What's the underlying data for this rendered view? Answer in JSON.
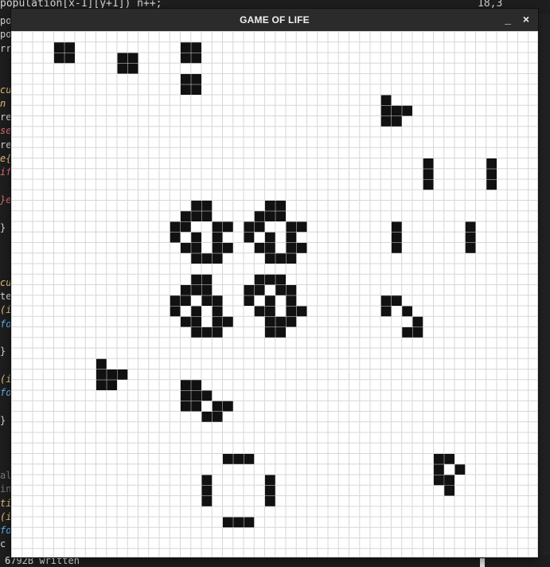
{
  "editor": {
    "top_line": "population[x-1][y+1]) n++;",
    "cursor_position": "18,3",
    "bottom_status": "6792B written",
    "left_fragments": [
      {
        "text": "po",
        "cls": "c-default"
      },
      {
        "text": "po",
        "cls": "c-default"
      },
      {
        "text": "rr",
        "cls": "c-default"
      },
      {
        "text": "",
        "cls": "c-default"
      },
      {
        "text": "",
        "cls": "c-default"
      },
      {
        "text": "cu",
        "cls": "c-yellow"
      },
      {
        "text": "n",
        "cls": "c-yellow"
      },
      {
        "text": "re",
        "cls": "c-default"
      },
      {
        "text": "se",
        "cls": "c-red"
      },
      {
        "text": "re",
        "cls": "c-default"
      },
      {
        "text": "e{",
        "cls": "c-yellow"
      },
      {
        "text": "if",
        "cls": "c-red"
      },
      {
        "text": "",
        "cls": "c-default"
      },
      {
        "text": "}e",
        "cls": "c-red"
      },
      {
        "text": "",
        "cls": "c-default"
      },
      {
        "text": "}",
        "cls": "c-default"
      },
      {
        "text": "",
        "cls": "c-default"
      },
      {
        "text": "",
        "cls": "c-default"
      },
      {
        "text": "",
        "cls": "c-default"
      },
      {
        "text": "cu",
        "cls": "c-yellow"
      },
      {
        "text": "te",
        "cls": "c-default"
      },
      {
        "text": "(i",
        "cls": "c-yellow"
      },
      {
        "text": "fo",
        "cls": "c-blue"
      },
      {
        "text": "",
        "cls": "c-default"
      },
      {
        "text": "}",
        "cls": "c-default"
      },
      {
        "text": "",
        "cls": "c-default"
      },
      {
        "text": "(i",
        "cls": "c-yellow"
      },
      {
        "text": "fo",
        "cls": "c-blue"
      },
      {
        "text": "",
        "cls": "c-default"
      },
      {
        "text": "}",
        "cls": "c-default"
      },
      {
        "text": "",
        "cls": "c-default"
      },
      {
        "text": "",
        "cls": "c-default"
      },
      {
        "text": "",
        "cls": "c-default"
      },
      {
        "text": "al",
        "cls": "c-dim"
      },
      {
        "text": "in",
        "cls": "c-dim"
      },
      {
        "text": "ti",
        "cls": "c-yellow"
      },
      {
        "text": "(i",
        "cls": "c-yellow"
      },
      {
        "text": "fo",
        "cls": "c-blue"
      },
      {
        "text": "c",
        "cls": "c-default"
      }
    ]
  },
  "window": {
    "title": "GAME OF LIFE",
    "minimize_label": "_",
    "close_label": "×"
  },
  "grid": {
    "columns": 50,
    "rows": 50,
    "cell_color": "#111111",
    "grid_line_color": "#d7d7d7",
    "background_color": "#ffffff",
    "cells": [
      [
        4,
        1
      ],
      [
        5,
        1
      ],
      [
        4,
        2
      ],
      [
        5,
        2
      ],
      [
        10,
        2
      ],
      [
        11,
        2
      ],
      [
        10,
        3
      ],
      [
        11,
        3
      ],
      [
        16,
        1
      ],
      [
        17,
        1
      ],
      [
        16,
        2
      ],
      [
        17,
        2
      ],
      [
        16,
        4
      ],
      [
        17,
        4
      ],
      [
        16,
        5
      ],
      [
        17,
        5
      ],
      [
        35,
        6
      ],
      [
        35,
        7
      ],
      [
        36,
        7
      ],
      [
        37,
        7
      ],
      [
        35,
        8
      ],
      [
        36,
        8
      ],
      [
        39,
        12
      ],
      [
        39,
        13
      ],
      [
        39,
        14
      ],
      [
        45,
        12
      ],
      [
        45,
        13
      ],
      [
        45,
        14
      ],
      [
        36,
        18
      ],
      [
        36,
        19
      ],
      [
        36,
        20
      ],
      [
        43,
        18
      ],
      [
        43,
        19
      ],
      [
        43,
        20
      ],
      [
        17,
        16
      ],
      [
        18,
        16
      ],
      [
        16,
        17
      ],
      [
        17,
        17
      ],
      [
        18,
        17
      ],
      [
        15,
        18
      ],
      [
        16,
        18
      ],
      [
        19,
        18
      ],
      [
        20,
        18
      ],
      [
        15,
        19
      ],
      [
        17,
        19
      ],
      [
        19,
        19
      ],
      [
        16,
        20
      ],
      [
        17,
        20
      ],
      [
        19,
        20
      ],
      [
        20,
        20
      ],
      [
        17,
        21
      ],
      [
        18,
        21
      ],
      [
        19,
        21
      ],
      [
        24,
        16
      ],
      [
        25,
        16
      ],
      [
        23,
        17
      ],
      [
        24,
        17
      ],
      [
        25,
        17
      ],
      [
        22,
        18
      ],
      [
        23,
        18
      ],
      [
        26,
        18
      ],
      [
        27,
        18
      ],
      [
        22,
        19
      ],
      [
        24,
        19
      ],
      [
        26,
        19
      ],
      [
        23,
        20
      ],
      [
        24,
        20
      ],
      [
        26,
        20
      ],
      [
        27,
        20
      ],
      [
        24,
        21
      ],
      [
        25,
        21
      ],
      [
        26,
        21
      ],
      [
        17,
        23
      ],
      [
        18,
        23
      ],
      [
        16,
        24
      ],
      [
        17,
        24
      ],
      [
        18,
        24
      ],
      [
        15,
        25
      ],
      [
        16,
        25
      ],
      [
        18,
        25
      ],
      [
        19,
        25
      ],
      [
        15,
        26
      ],
      [
        17,
        26
      ],
      [
        19,
        26
      ],
      [
        16,
        27
      ],
      [
        17,
        27
      ],
      [
        19,
        27
      ],
      [
        20,
        27
      ],
      [
        17,
        28
      ],
      [
        18,
        28
      ],
      [
        19,
        28
      ],
      [
        23,
        23
      ],
      [
        24,
        23
      ],
      [
        25,
        23
      ],
      [
        22,
        24
      ],
      [
        23,
        24
      ],
      [
        25,
        24
      ],
      [
        26,
        24
      ],
      [
        22,
        25
      ],
      [
        24,
        25
      ],
      [
        26,
        25
      ],
      [
        23,
        26
      ],
      [
        24,
        26
      ],
      [
        26,
        26
      ],
      [
        27,
        26
      ],
      [
        24,
        27
      ],
      [
        25,
        27
      ],
      [
        26,
        27
      ],
      [
        24,
        28
      ],
      [
        25,
        28
      ],
      [
        35,
        25
      ],
      [
        36,
        25
      ],
      [
        35,
        26
      ],
      [
        37,
        26
      ],
      [
        38,
        27
      ],
      [
        37,
        28
      ],
      [
        38,
        28
      ],
      [
        8,
        31
      ],
      [
        8,
        32
      ],
      [
        9,
        32
      ],
      [
        10,
        32
      ],
      [
        8,
        33
      ],
      [
        9,
        33
      ],
      [
        16,
        33
      ],
      [
        17,
        33
      ],
      [
        16,
        34
      ],
      [
        17,
        34
      ],
      [
        18,
        34
      ],
      [
        16,
        35
      ],
      [
        17,
        35
      ],
      [
        19,
        35
      ],
      [
        20,
        35
      ],
      [
        18,
        36
      ],
      [
        19,
        36
      ],
      [
        40,
        40
      ],
      [
        41,
        40
      ],
      [
        40,
        41
      ],
      [
        42,
        41
      ],
      [
        40,
        42
      ],
      [
        41,
        42
      ],
      [
        41,
        42
      ],
      [
        41,
        43
      ],
      [
        20,
        40
      ],
      [
        21,
        40
      ],
      [
        22,
        40
      ],
      [
        18,
        42
      ],
      [
        18,
        43
      ],
      [
        18,
        44
      ],
      [
        24,
        42
      ],
      [
        24,
        43
      ],
      [
        24,
        44
      ],
      [
        20,
        46
      ],
      [
        21,
        46
      ],
      [
        22,
        46
      ]
    ]
  }
}
